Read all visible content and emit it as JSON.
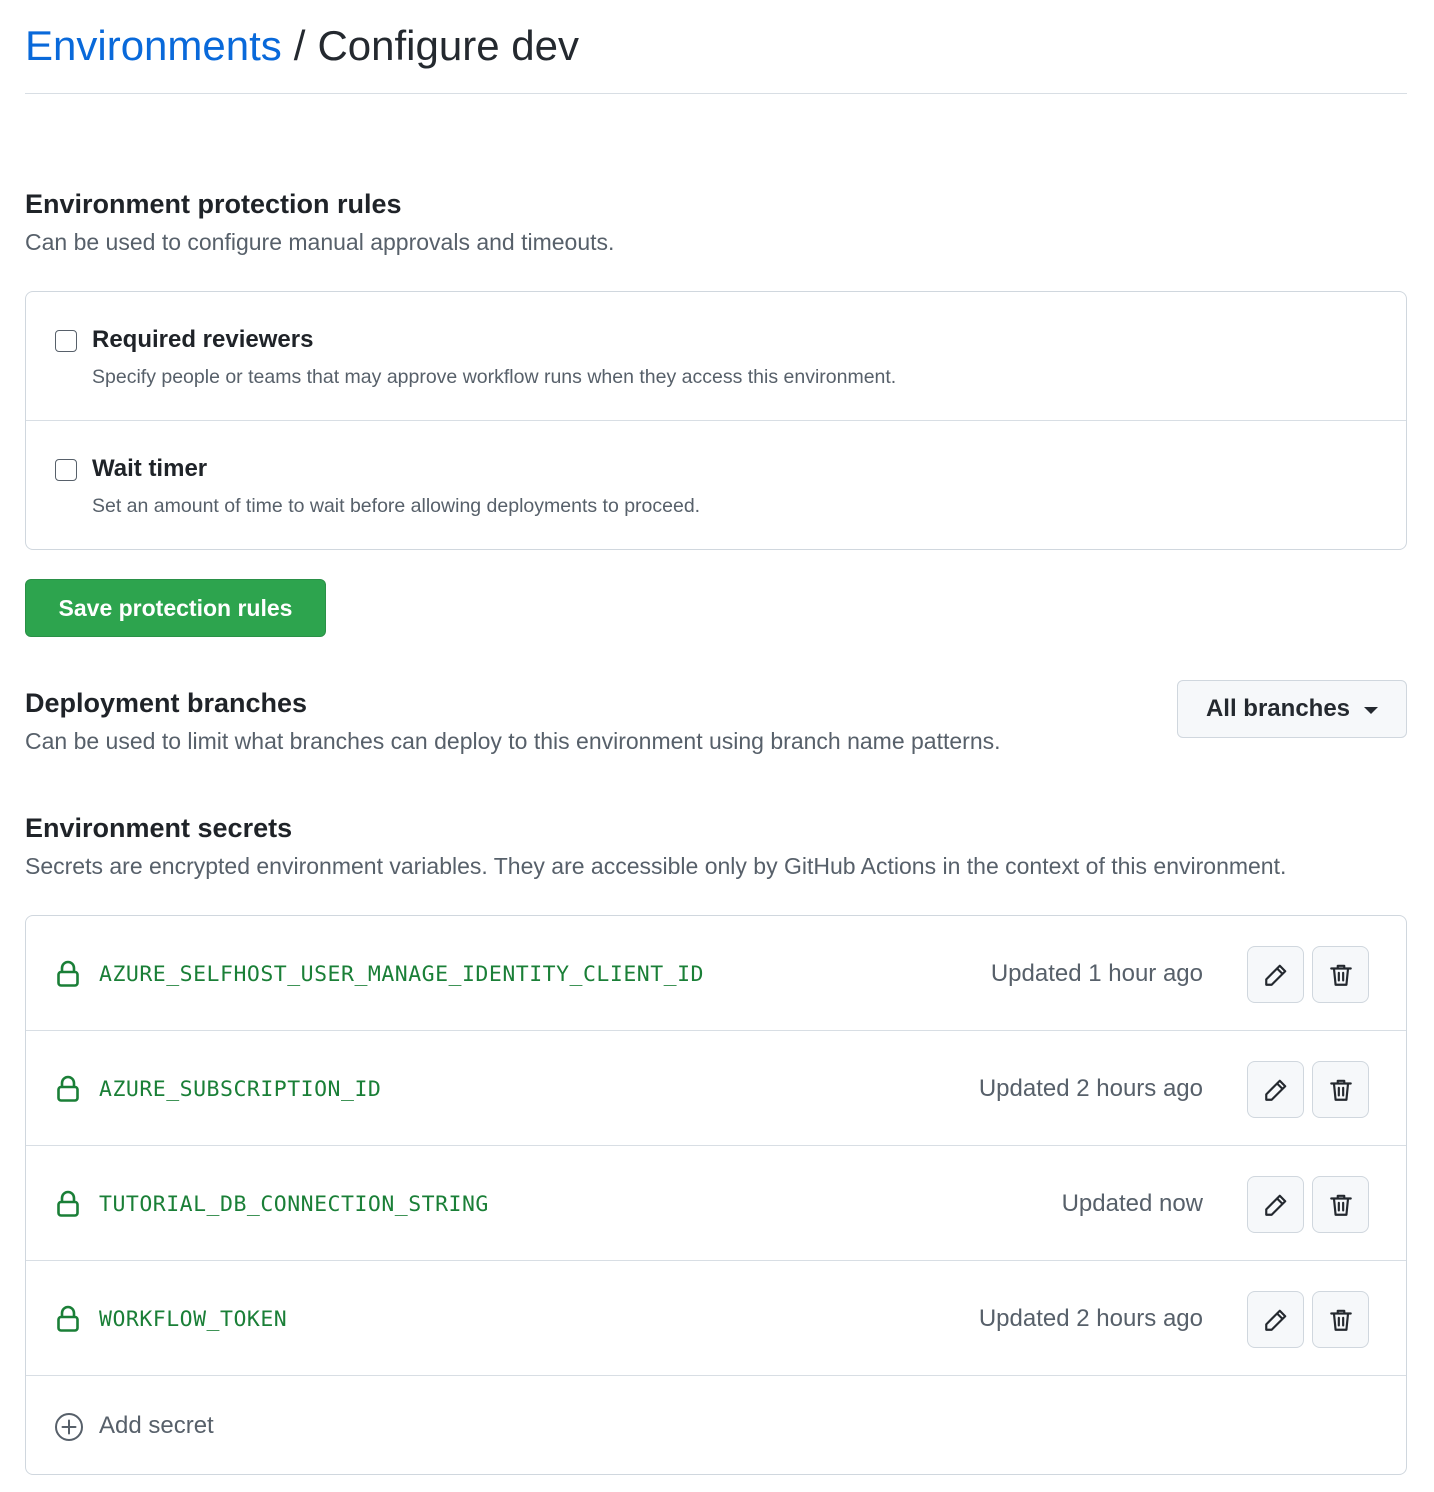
{
  "header": {
    "breadcrumb_link": "Environments",
    "separator": "/",
    "current": "Configure dev"
  },
  "protection": {
    "title": "Environment protection rules",
    "description": "Can be used to configure manual approvals and timeouts.",
    "rules": [
      {
        "label": "Required reviewers",
        "description": "Specify people or teams that may approve workflow runs when they access this environment.",
        "checked": false
      },
      {
        "label": "Wait timer",
        "description": "Set an amount of time to wait before allowing deployments to proceed.",
        "checked": false
      }
    ],
    "save_label": "Save protection rules"
  },
  "branches": {
    "title": "Deployment branches",
    "description": "Can be used to limit what branches can deploy to this environment using branch name patterns.",
    "dropdown_value": "All branches"
  },
  "secrets": {
    "title": "Environment secrets",
    "description": "Secrets are encrypted environment variables. They are accessible only by GitHub Actions in the context of this environment.",
    "items": [
      {
        "name": "AZURE_SELFHOST_USER_MANAGE_IDENTITY_CLIENT_ID",
        "updated": "Updated 1 hour ago"
      },
      {
        "name": "AZURE_SUBSCRIPTION_ID",
        "updated": "Updated 2 hours ago"
      },
      {
        "name": "TUTORIAL_DB_CONNECTION_STRING",
        "updated": "Updated now"
      },
      {
        "name": "WORKFLOW_TOKEN",
        "updated": "Updated 2 hours ago"
      }
    ],
    "add_label": "Add secret"
  },
  "icons": {
    "secret": "lock-icon",
    "edit": "pencil-icon",
    "delete": "trash-icon",
    "add": "plus-circle-icon",
    "dropdown": "caret-down-icon"
  },
  "colors": {
    "link": "#0969da",
    "primary_button": "#2da44e",
    "secret_name": "#1a7f37",
    "muted_text": "#57606a",
    "border": "#d0d7de"
  }
}
